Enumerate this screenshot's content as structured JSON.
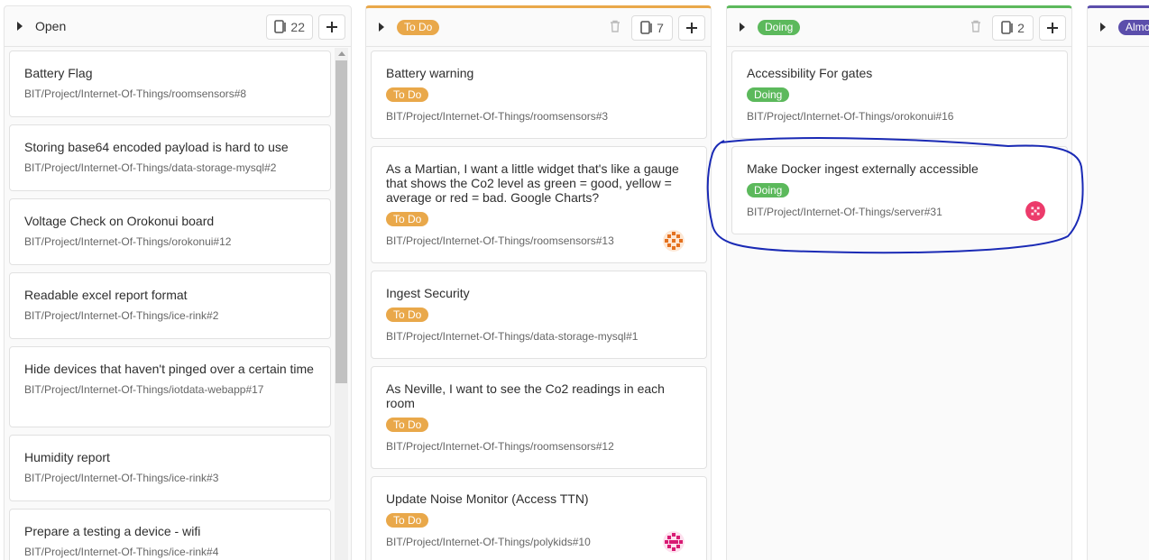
{
  "columns": {
    "open": {
      "title": "Open",
      "count": "22",
      "cards": [
        {
          "title": "Battery Flag",
          "ref": "BIT/Project/Internet-Of-Things/roomsensors#8"
        },
        {
          "title": "Storing base64 encoded payload is hard to use",
          "ref": "BIT/Project/Internet-Of-Things/data-storage-mysql#2"
        },
        {
          "title": "Voltage Check on Orokonui board",
          "ref": "BIT/Project/Internet-Of-Things/orokonui#12"
        },
        {
          "title": "Readable excel report format",
          "ref": "BIT/Project/Internet-Of-Things/ice-rink#2"
        },
        {
          "title": "Hide devices that haven't pinged over a certain time",
          "ref": "BIT/Project/Internet-Of-Things/iotdata-webapp#17"
        },
        {
          "title": "Humidity report",
          "ref": "BIT/Project/Internet-Of-Things/ice-rink#3"
        },
        {
          "title": "Prepare a testing a device - wifi",
          "ref": "BIT/Project/Internet-Of-Things/ice-rink#4"
        }
      ]
    },
    "todo": {
      "title": "To Do",
      "count": "7",
      "color": "#e9a84a",
      "cards": [
        {
          "title": "Battery warning",
          "label": "To Do",
          "ref": "BIT/Project/Internet-Of-Things/roomsensors#3"
        },
        {
          "title": "As a Martian, I want a little widget that's like a gauge that shows the Co2 level as green = good, yellow = average or red = bad. Google Charts?",
          "label": "To Do",
          "ref": "BIT/Project/Internet-Of-Things/roomsensors#13"
        },
        {
          "title": "Ingest Security",
          "label": "To Do",
          "ref": "BIT/Project/Internet-Of-Things/data-storage-mysql#1"
        },
        {
          "title": "As Neville, I want to see the Co2 readings in each room",
          "label": "To Do",
          "ref": "BIT/Project/Internet-Of-Things/roomsensors#12"
        },
        {
          "title": "Update Noise Monitor (Access TTN)",
          "label": "To Do",
          "ref": "BIT/Project/Internet-Of-Things/polykids#10"
        }
      ]
    },
    "doing": {
      "title": "Doing",
      "count": "2",
      "color": "#5cb95c",
      "cards": [
        {
          "title": "Accessibility For gates",
          "label": "Doing",
          "ref": "BIT/Project/Internet-Of-Things/orokonui#16"
        },
        {
          "title": "Make Docker ingest externally accessible",
          "label": "Doing",
          "ref": "BIT/Project/Internet-Of-Things/server#31"
        }
      ]
    },
    "almost": {
      "title": "Almo",
      "color": "#5b4eab"
    }
  },
  "icons": {
    "collapse": "caret-right-icon",
    "count": "issues-icon",
    "add": "plus-icon",
    "delete": "trash-icon"
  },
  "colors": {
    "annotation": "#1a2ab5"
  }
}
